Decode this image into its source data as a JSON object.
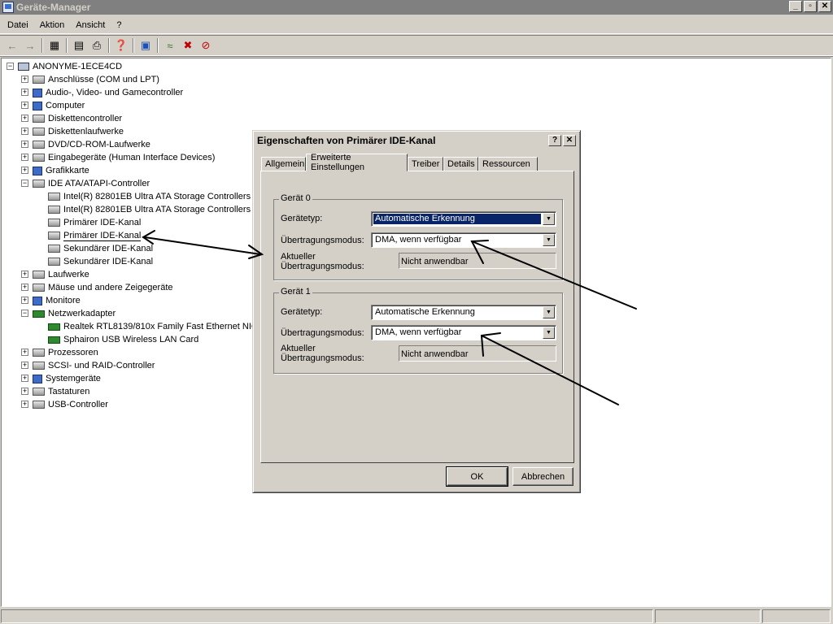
{
  "window": {
    "title": "Geräte-Manager",
    "buttons": [
      "_",
      "▫",
      "✕"
    ]
  },
  "menu": [
    "Datei",
    "Aktion",
    "Ansicht",
    "?"
  ],
  "tree": {
    "root": "ANONYME-1ECE4CD",
    "items": [
      {
        "label": "Anschlüsse (COM und LPT)",
        "expanded": false
      },
      {
        "label": "Audio-, Video- und Gamecontroller",
        "expanded": false
      },
      {
        "label": "Computer",
        "expanded": false
      },
      {
        "label": "Diskettencontroller",
        "expanded": false
      },
      {
        "label": "Diskettenlaufwerke",
        "expanded": false
      },
      {
        "label": "DVD/CD-ROM-Laufwerke",
        "expanded": false
      },
      {
        "label": "Eingabegeräte (Human Interface Devices)",
        "expanded": false
      },
      {
        "label": "Grafikkarte",
        "expanded": false
      },
      {
        "label": "IDE ATA/ATAPI-Controller",
        "expanded": true
      },
      {
        "label": "Intel(R) 82801EB Ultra ATA Storage Controllers",
        "child": true
      },
      {
        "label": "Intel(R) 82801EB Ultra ATA Storage Controllers",
        "child": true
      },
      {
        "label": "Primärer IDE-Kanal",
        "child": true
      },
      {
        "label": "Primärer IDE-Kanal",
        "child": true,
        "selected": true
      },
      {
        "label": "Sekundärer IDE-Kanal",
        "child": true
      },
      {
        "label": "Sekundärer IDE-Kanal",
        "child": true
      },
      {
        "label": "Laufwerke",
        "expanded": false
      },
      {
        "label": "Mäuse und andere Zeigegeräte",
        "expanded": false
      },
      {
        "label": "Monitore",
        "expanded": false
      },
      {
        "label": "Netzwerkadapter",
        "expanded": true
      },
      {
        "label": "Realtek RTL8139/810x Family Fast Ethernet NIC",
        "child": true
      },
      {
        "label": "Sphairon USB Wireless LAN Card",
        "child": true
      },
      {
        "label": "Prozessoren",
        "expanded": false
      },
      {
        "label": "SCSI- und RAID-Controller",
        "expanded": false
      },
      {
        "label": "Systemgeräte",
        "expanded": false
      },
      {
        "label": "Tastaturen",
        "expanded": false
      },
      {
        "label": "USB-Controller",
        "expanded": false
      }
    ]
  },
  "dialog": {
    "title": "Eigenschaften von Primärer IDE-Kanal",
    "help": "?",
    "close": "✕",
    "tabs": [
      "Allgemein",
      "Erweiterte Einstellungen",
      "Treiber",
      "Details",
      "Ressourcen"
    ],
    "active_tab": 1,
    "device0": {
      "label": "Gerät 0",
      "type_label": "Gerätetyp:",
      "type_value": "Automatische Erkennung",
      "mode_label": "Übertragungsmodus:",
      "mode_value": "DMA, wenn verfügbar",
      "current_label_1": "Aktueller",
      "current_label_2": "Übertragungsmodus:",
      "current_value": "Nicht anwendbar"
    },
    "device1": {
      "label": "Gerät 1",
      "type_label": "Gerätetyp:",
      "type_value": "Automatische Erkennung",
      "mode_label": "Übertragungsmodus:",
      "mode_value": "DMA, wenn verfügbar",
      "current_label_1": "Aktueller",
      "current_label_2": "Übertragungsmodus:",
      "current_value": "Nicht anwendbar"
    },
    "ok": "OK",
    "cancel": "Abbrechen"
  },
  "colors": {
    "selection": "#0a246a",
    "face": "#d4d0c8",
    "annotation": "#000000"
  }
}
